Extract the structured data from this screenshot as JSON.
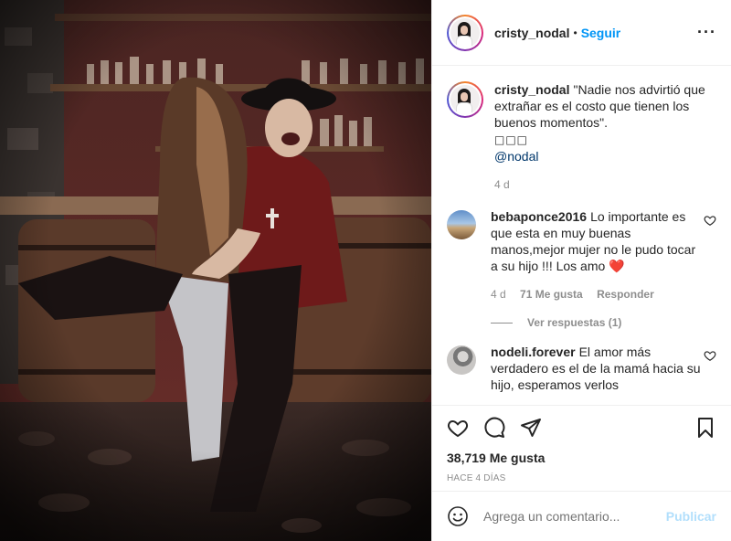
{
  "post": {
    "username": "cristy_nodal",
    "follow_label": "Seguir",
    "more_icon": "more-options-icon",
    "caption": {
      "text": "\"Nadie nos advirtió que extrañar es el costo que tienen los buenos momentos\".",
      "symbols": "□□□",
      "mention": "@nodal",
      "time": "4 d"
    },
    "comments": [
      {
        "username": "bebaponce2016",
        "text": "Lo importante es que esta en muy buenas manos,mejor mujer no le pudo tocar a su hijo !!! Los amo ❤️",
        "time": "4 d",
        "likes": "71 Me gusta",
        "reply": "Responder",
        "view_replies": "Ver respuestas (1)"
      },
      {
        "username": "nodeli.forever",
        "text": "El amor más verdadero es el de la mamá hacia su hijo, esperamos verlos"
      }
    ],
    "likes_count": "38,719 Me gusta",
    "posted_ago": "HACE 4 DÍAS",
    "comment_placeholder": "Agrega un comentario...",
    "publish_label": "Publicar",
    "accent_color": "#0095f6"
  }
}
